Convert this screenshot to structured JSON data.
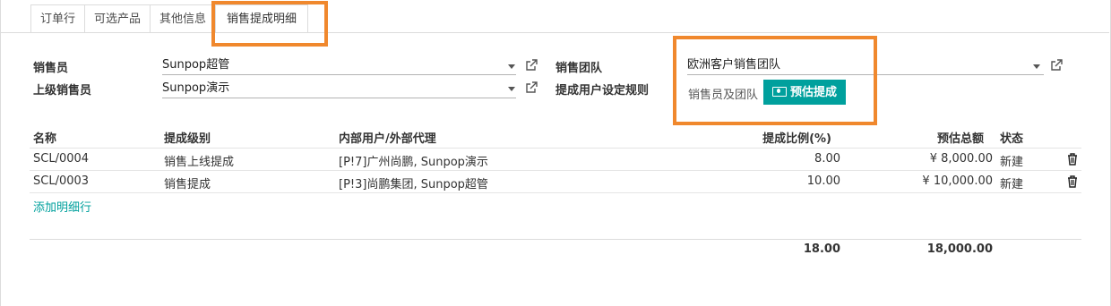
{
  "tabs": [
    {
      "label": "订单行"
    },
    {
      "label": "可选产品"
    },
    {
      "label": "其他信息"
    },
    {
      "label": "销售提成明细",
      "active": true
    }
  ],
  "form": {
    "salesperson_label": "销售员",
    "salesperson_value": "Sunpop超管",
    "superior_label": "上级销售员",
    "superior_value": "Sunpop演示",
    "team_label": "销售团队",
    "team_value": "欧洲客户销售团队",
    "rule_label": "提成用户设定规则",
    "rule_value": "销售员及团队",
    "estimate_button": "预估提成"
  },
  "table": {
    "headers": [
      "名称",
      "提成级别",
      "内部用户/外部代理",
      "提成比例(%)",
      "预估总额",
      "状态"
    ],
    "rows": [
      [
        "SCL/0004",
        "销售上线提成",
        "[P!7]广州尚鹏, Sunpop演示",
        "8.00",
        "¥ 8,000.00",
        "新建"
      ],
      [
        "SCL/0003",
        "销售提成",
        "[P!3]尚鹏集团, Sunpop超管",
        "10.00",
        "¥ 10,000.00",
        "新建"
      ]
    ],
    "add_line": "添加明细行",
    "totals": {
      "ratio": "18.00",
      "amount": "18,000.00"
    }
  },
  "colors": {
    "accent": "#00a09d",
    "highlight": "#f0882d"
  }
}
